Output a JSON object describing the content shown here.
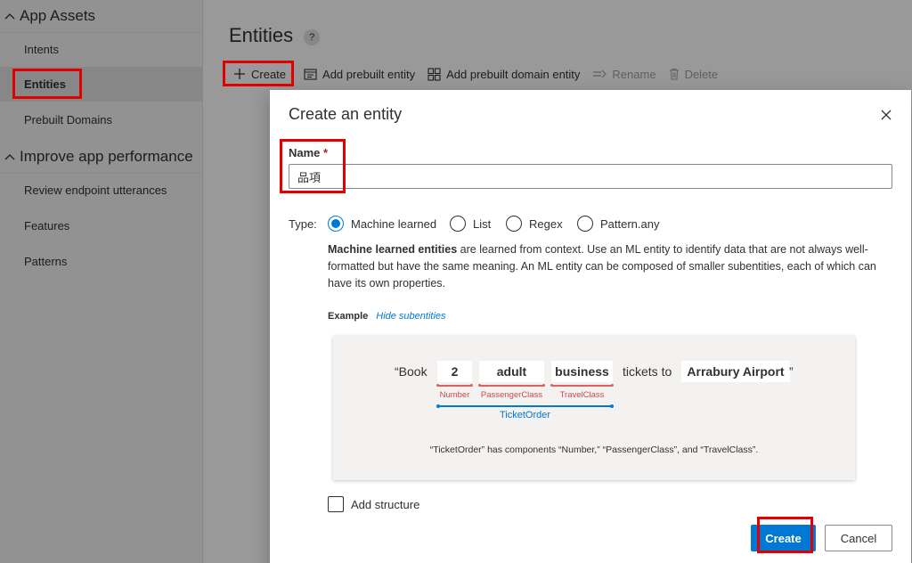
{
  "sidebar": {
    "section_app_assets": "App Assets",
    "items": [
      {
        "label": "Intents"
      },
      {
        "label": "Entities"
      },
      {
        "label": "Prebuilt Domains"
      }
    ],
    "section_improve": "Improve app performance",
    "improve_items": [
      {
        "label": "Review endpoint utterances"
      },
      {
        "label": "Features"
      },
      {
        "label": "Patterns"
      }
    ]
  },
  "page": {
    "title": "Entities",
    "help": "?"
  },
  "toolbar": {
    "create": "Create",
    "add_prebuilt": "Add prebuilt entity",
    "add_prebuilt_domain": "Add prebuilt domain entity",
    "rename": "Rename",
    "delete": "Delete"
  },
  "modal": {
    "title": "Create an entity",
    "name_label": "Name",
    "required_mark": "*",
    "name_value": "品項",
    "type_label": "Type:",
    "types": [
      {
        "label": "Machine learned",
        "selected": true
      },
      {
        "label": "List",
        "selected": false
      },
      {
        "label": "Regex",
        "selected": false
      },
      {
        "label": "Pattern.any",
        "selected": false
      }
    ],
    "description_bold": "Machine learned entities",
    "description_rest": " are learned from context. Use an ML entity to identify data that are not always well-formatted but have the same meaning. An ML entity can be composed of smaller subentities, each of which can have its own properties.",
    "example_label": "Example",
    "hide_subentities": "Hide subentities",
    "add_structure": "Add structure",
    "create_button": "Create",
    "cancel_button": "Cancel"
  },
  "example": {
    "open_quote_book": "“Book",
    "chip_number": "2",
    "chip_adult": "adult",
    "chip_business": "business",
    "tickets_to": "tickets to",
    "chip_airport": "Arrabury Airport",
    "close_quote": "”",
    "label_number": "Number",
    "label_passenger": "PassengerClass",
    "label_travel": "TravelClass",
    "label_ticket_order": "TicketOrder",
    "caption": "“TicketOrder” has components “Number,” “PassengerClass”, and “TravelClass”."
  },
  "colors": {
    "accent": "#0078d4",
    "highlight": "#e00000",
    "subentity_red": "#e06060"
  }
}
